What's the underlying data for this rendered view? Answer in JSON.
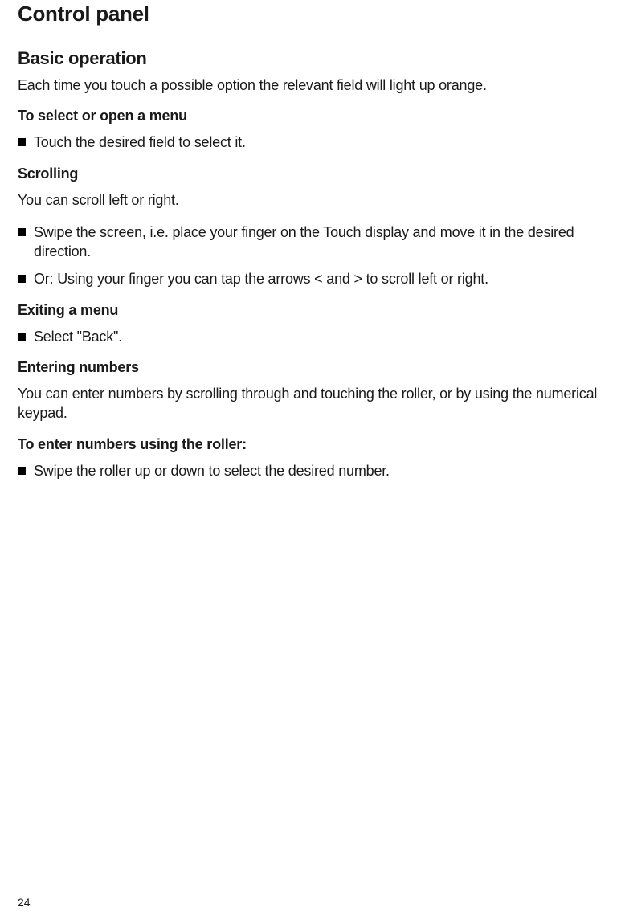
{
  "page_title": "Control panel",
  "section_heading": "Basic operation",
  "intro_text": "Each time you touch a possible option the relevant field will light up orange.",
  "select_menu": {
    "heading": "To select or open a menu",
    "bullets": [
      "Touch the desired field to select it."
    ]
  },
  "scrolling": {
    "heading": "Scrolling",
    "intro": "You can scroll left or right.",
    "bullets": [
      "Swipe the screen, i.e. place your finger on the Touch display and move it in the desired direction.",
      "Or: Using your finger you can tap the arrows < and > to scroll left or right."
    ]
  },
  "exiting": {
    "heading": "Exiting a menu",
    "bullets": [
      "Select \"Back\"."
    ]
  },
  "entering_numbers": {
    "heading": "Entering numbers",
    "intro": "You can enter numbers by scrolling through and touching the roller, or by using the numerical keypad."
  },
  "roller": {
    "heading": "To enter numbers using the roller:",
    "bullets": [
      "Swipe the roller up or down to select the desired number."
    ]
  },
  "page_number": "24"
}
